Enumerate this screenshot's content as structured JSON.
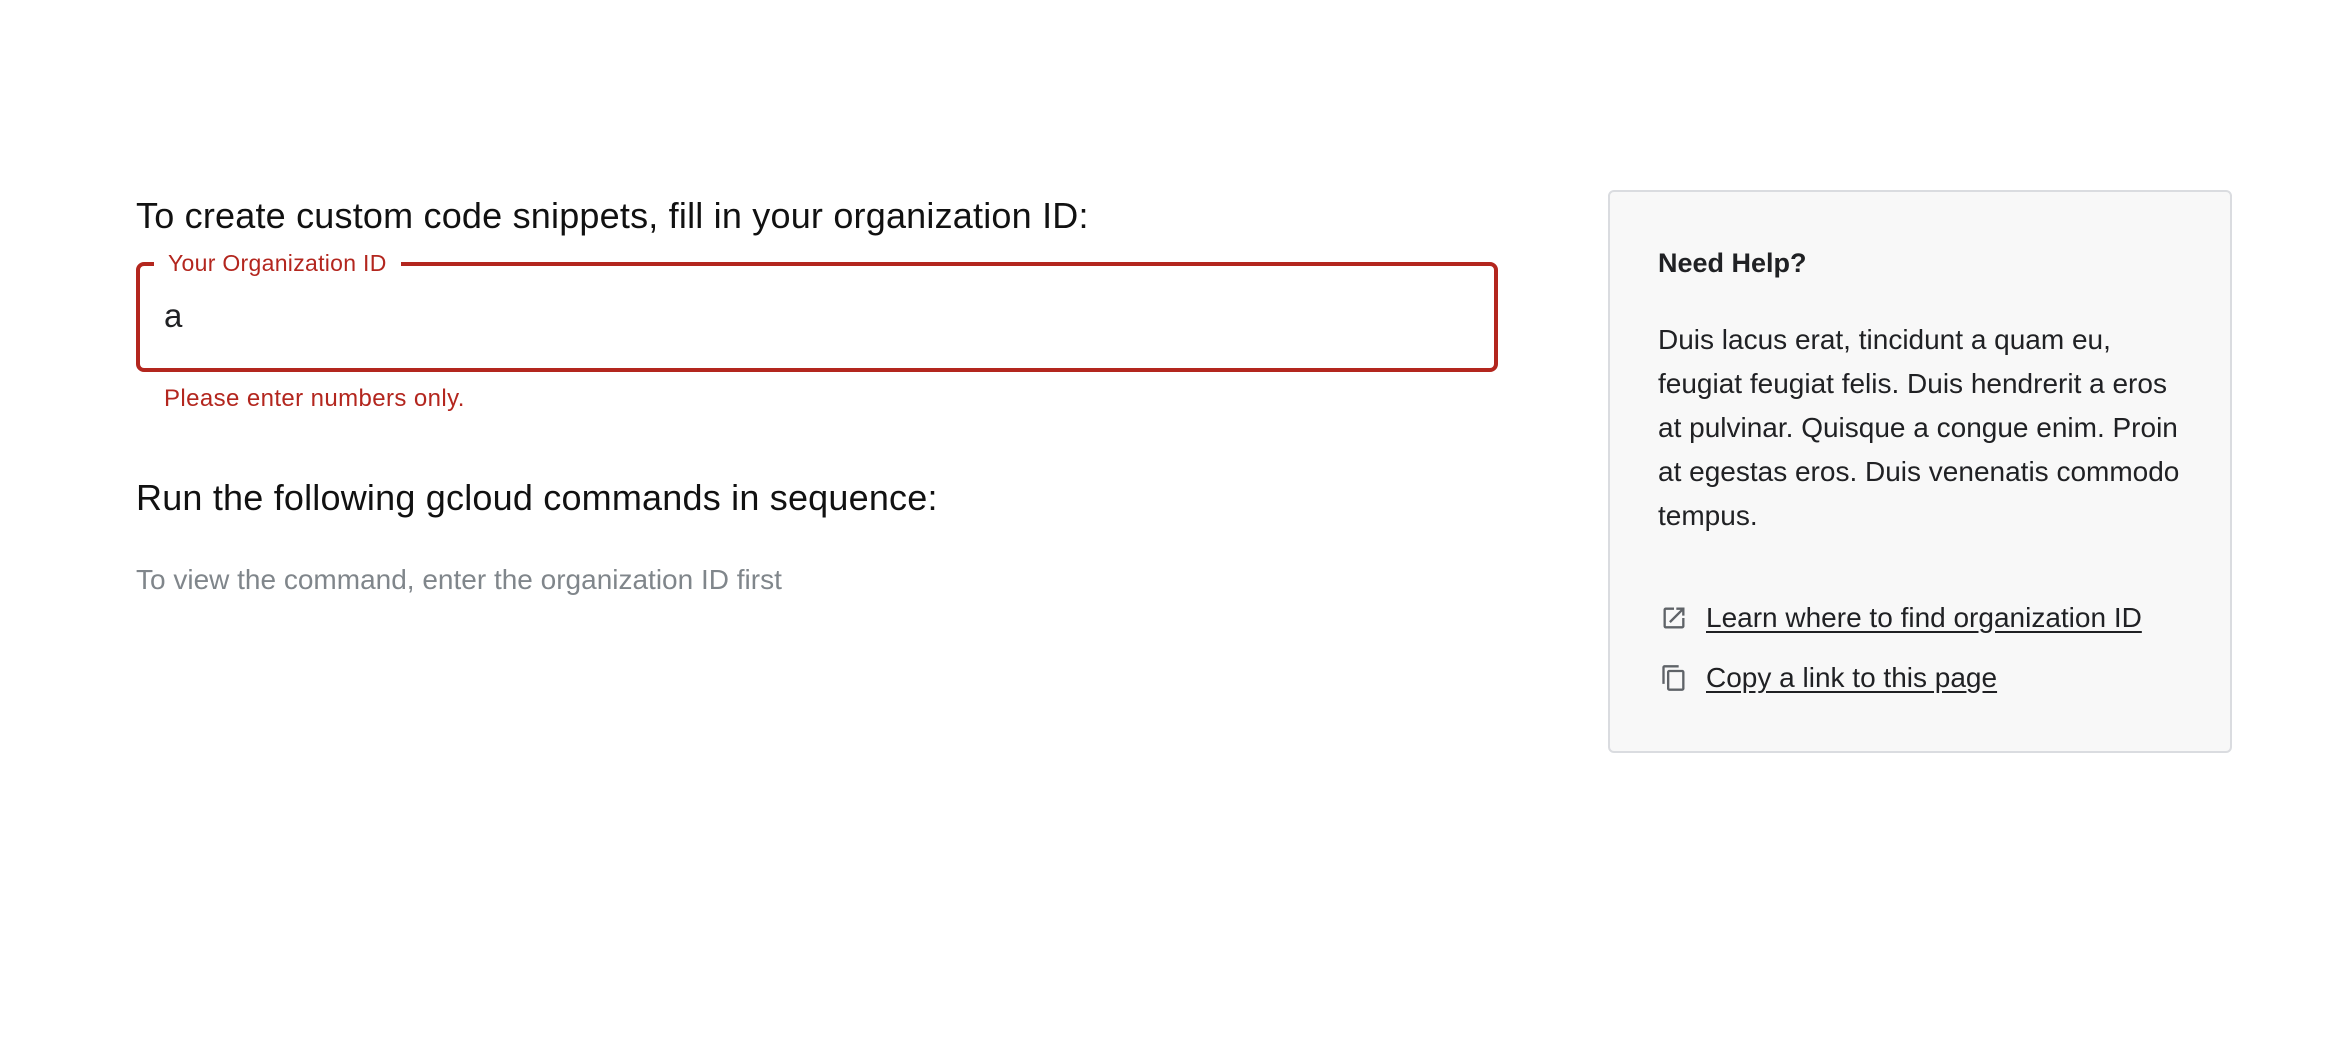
{
  "main": {
    "heading": "To create custom code snippets, fill in your organization ID:",
    "org_field": {
      "label": "Your Organization ID",
      "value": "a",
      "error": "Please enter numbers only."
    },
    "commands_heading": "Run the following gcloud commands in sequence:",
    "commands_hint": "To view the command, enter the organization ID first"
  },
  "help": {
    "title": "Need Help?",
    "body": "Duis lacus erat, tincidunt a quam eu, feugiat feugiat felis. Duis hendrerit a eros at pulvinar. Quisque a congue enim. Proin at egestas eros. Duis venenatis commodo tempus.",
    "links": [
      {
        "icon": "open-in-new-icon",
        "label": "Learn where to find organization ID"
      },
      {
        "icon": "copy-icon",
        "label": "Copy a link to this page"
      }
    ]
  },
  "colors": {
    "error": "#b3261e",
    "panel_bg": "#f8f8f8",
    "hint": "#80868b"
  }
}
